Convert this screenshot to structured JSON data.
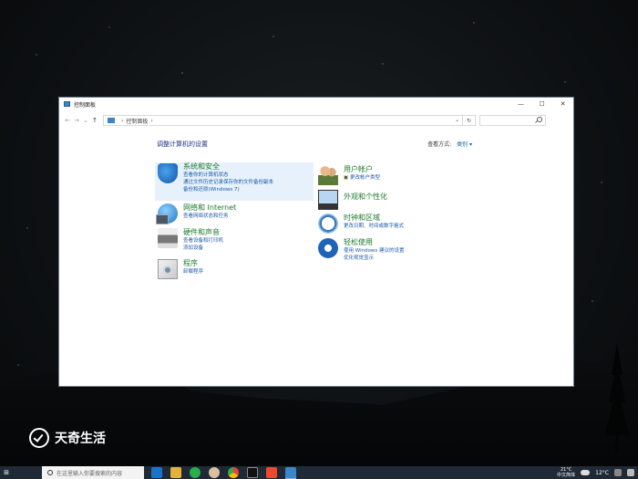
{
  "window": {
    "title": "控制面板",
    "min_glyph": "—",
    "max_glyph": "☐",
    "close_glyph": "✕"
  },
  "nav": {
    "back_glyph": "←",
    "forward_glyph": "→",
    "recent_glyph": "⌄",
    "up_glyph": "↑",
    "breadcrumb": "控制面板",
    "crumb_sep": "›",
    "refresh_glyph": "↻",
    "search_placeholder": ""
  },
  "main": {
    "heading": "调整计算机的设置",
    "view_by_label": "查看方式:",
    "view_by_value": "类别 ▾"
  },
  "categories": {
    "system": {
      "title": "系统和安全",
      "links": [
        "查看你的计算机状态",
        "通过文件历史记录保存你的文件备份副本",
        "备份和还原(Windows 7)"
      ]
    },
    "network": {
      "title": "网络和 Internet",
      "links": [
        "查看网络状态和任务"
      ]
    },
    "hardware": {
      "title": "硬件和声音",
      "links": [
        "查看设备和打印机",
        "添加设备"
      ]
    },
    "programs": {
      "title": "程序",
      "links": [
        "卸载程序"
      ]
    },
    "users": {
      "title": "用户帐户",
      "links": [
        "更改帐户类型"
      ]
    },
    "appearance": {
      "title": "外观和个性化",
      "links": []
    },
    "clock": {
      "title": "时钟和区域",
      "links": [
        "更改日期、时间或数字格式"
      ]
    },
    "ease": {
      "title": "轻松使用",
      "links": [
        "使用 Windows 建议的设置",
        "优化视觉显示"
      ]
    }
  },
  "watermark": {
    "text": "天奇生活"
  },
  "taskbar": {
    "start_glyph": "⊞",
    "search_placeholder": "在这里输入你要搜索的内容",
    "temperature": "12°C",
    "clock_top": "21°C",
    "clock_bottom": "中文简体"
  },
  "colors": {
    "link": "#1c58a8",
    "category_title": "#1e7b2f",
    "heading": "#1e3287",
    "highlight": "#e6f1fb",
    "taskbar": "#1f2a36"
  }
}
